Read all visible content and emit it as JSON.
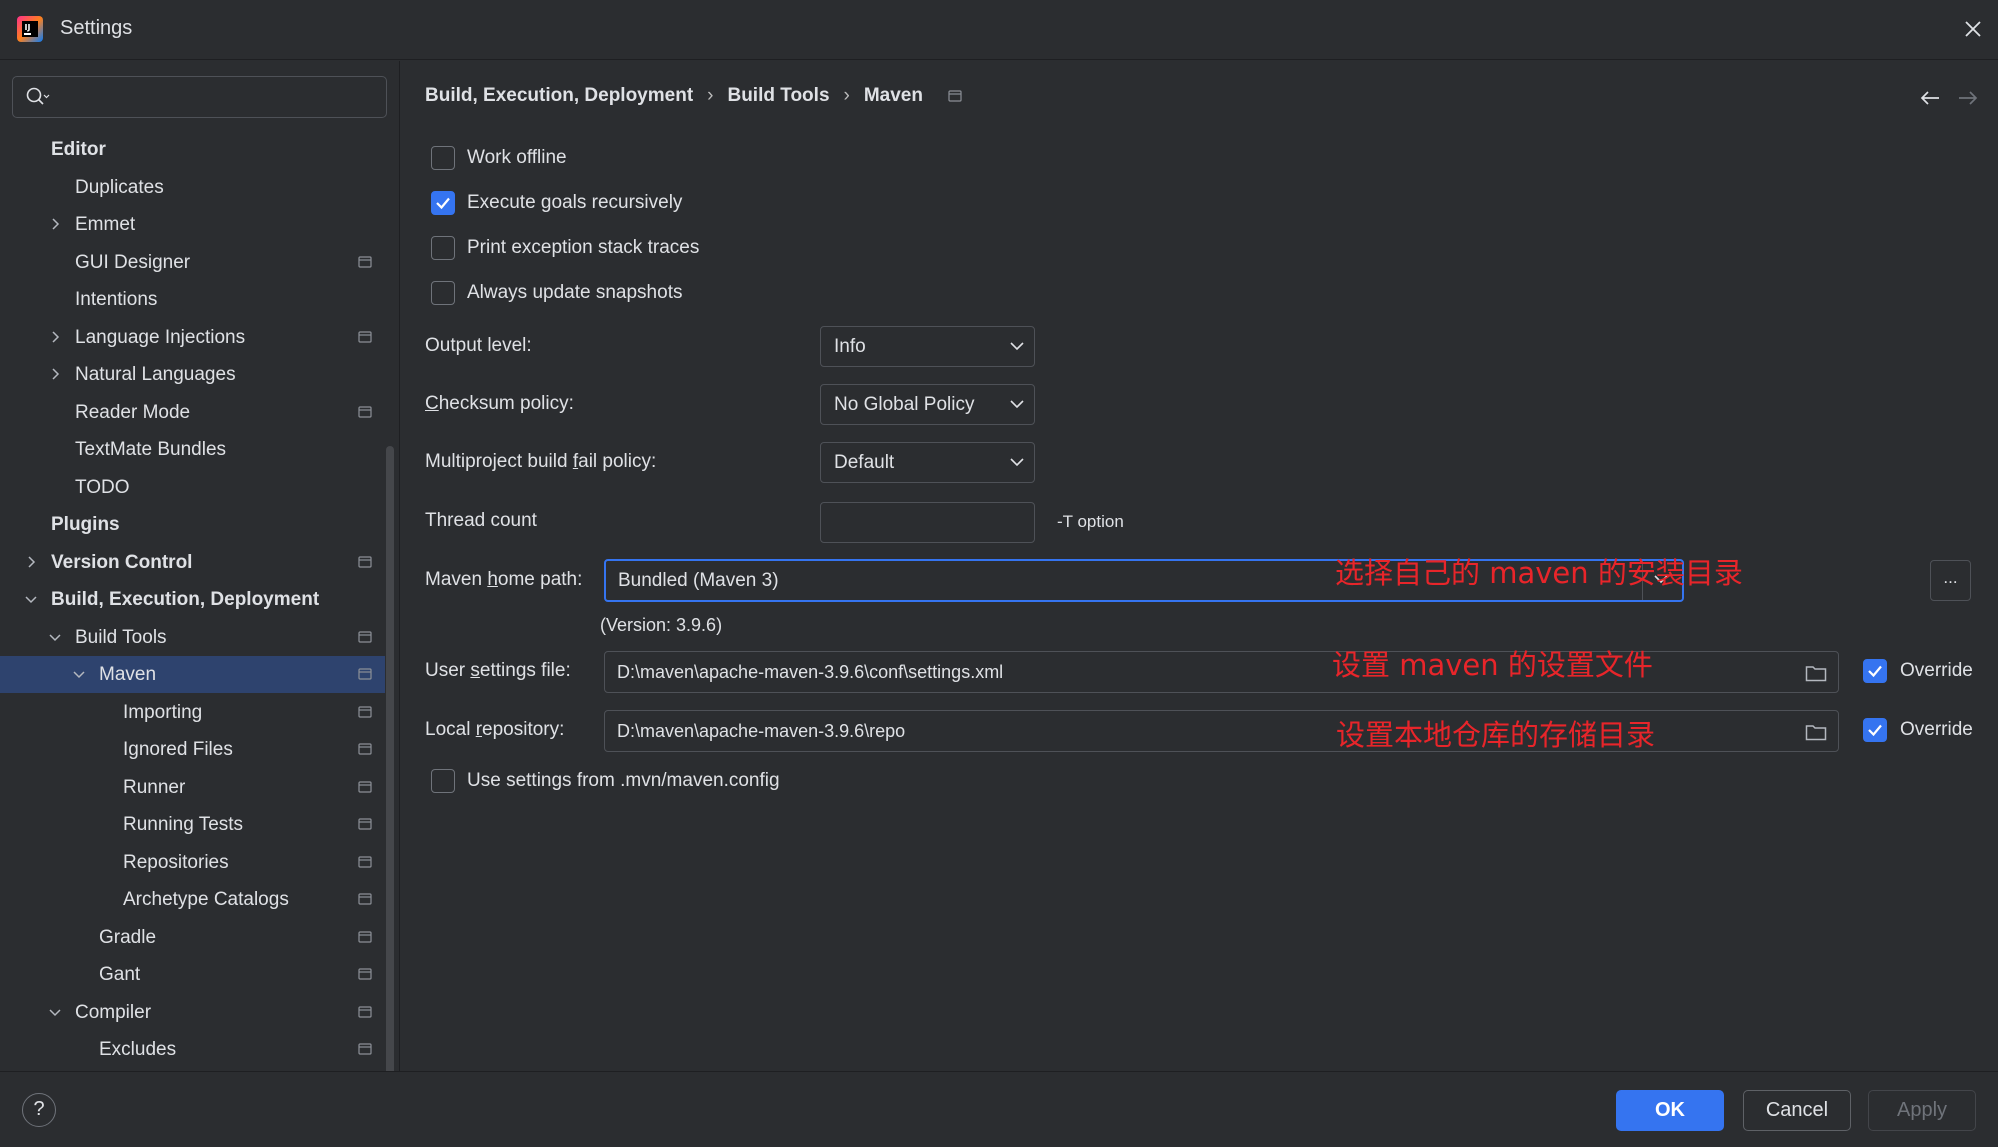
{
  "window": {
    "title": "Settings"
  },
  "search": {
    "placeholder": ""
  },
  "sidebar": {
    "items": [
      {
        "label": "Editor"
      },
      {
        "label": "Duplicates"
      },
      {
        "label": "Emmet"
      },
      {
        "label": "GUI Designer"
      },
      {
        "label": "Intentions"
      },
      {
        "label": "Language Injections"
      },
      {
        "label": "Natural Languages"
      },
      {
        "label": "Reader Mode"
      },
      {
        "label": "TextMate Bundles"
      },
      {
        "label": "TODO"
      },
      {
        "label": "Plugins"
      },
      {
        "label": "Version Control"
      },
      {
        "label": "Build, Execution, Deployment"
      },
      {
        "label": "Build Tools"
      },
      {
        "label": "Maven"
      },
      {
        "label": "Importing"
      },
      {
        "label": "Ignored Files"
      },
      {
        "label": "Runner"
      },
      {
        "label": "Running Tests"
      },
      {
        "label": "Repositories"
      },
      {
        "label": "Archetype Catalogs"
      },
      {
        "label": "Gradle"
      },
      {
        "label": "Gant"
      },
      {
        "label": "Compiler"
      },
      {
        "label": "Excludes"
      }
    ]
  },
  "breadcrumb": {
    "items": [
      "Build, Execution, Deployment",
      "Build Tools",
      "Maven"
    ],
    "separator": "›"
  },
  "options": {
    "work_offline": {
      "label": "Work offline",
      "checked": false
    },
    "execute_goals": {
      "label": "Execute goals recursively",
      "checked": true
    },
    "print_exception": {
      "label": "Print exception stack traces",
      "checked": false
    },
    "always_update": {
      "label": "Always update snapshots",
      "checked": false
    },
    "use_mvn_config": {
      "label": "Use settings from .mvn/maven.config",
      "checked": false
    }
  },
  "form": {
    "output_level": {
      "label": "Output level:",
      "value": "Info"
    },
    "checksum_policy": {
      "label_first": "C",
      "label_rest": "hecksum policy:",
      "value": "No Global Policy"
    },
    "multiproject": {
      "label_pre": "Multiproject build ",
      "label_u": "f",
      "label_post": "ail policy:",
      "value": "Default"
    },
    "thread_count": {
      "label": "Thread count",
      "value": "",
      "hint": "-T option"
    },
    "maven_home": {
      "label_pre": "Maven ",
      "label_u": "h",
      "label_post": "ome path:",
      "value": "Bundled (Maven 3)",
      "browse": "...",
      "version": "(Version: 3.9.6)"
    },
    "user_settings": {
      "label_pre": "User ",
      "label_u": "s",
      "label_post": "ettings file:",
      "value": "D:\\maven\\apache-maven-3.9.6\\conf\\settings.xml",
      "override_label": "Override",
      "override_checked": true
    },
    "local_repo": {
      "label_pre": "Local ",
      "label_u": "r",
      "label_post": "epository:",
      "value": "D:\\maven\\apache-maven-3.9.6\\repo",
      "override_label": "Override",
      "override_checked": true
    }
  },
  "annotations": {
    "maven_home": "选择自己的 maven 的安装目录",
    "user_settings": "设置 maven 的设置文件",
    "local_repo": "设置本地仓库的存储目录"
  },
  "buttons": {
    "help": "?",
    "ok": "OK",
    "cancel": "Cancel",
    "apply": "Apply"
  },
  "colors": {
    "accent": "#3574f0",
    "selection": "#2e436e",
    "annotation": "#e8252a",
    "background": "#2b2d30"
  }
}
